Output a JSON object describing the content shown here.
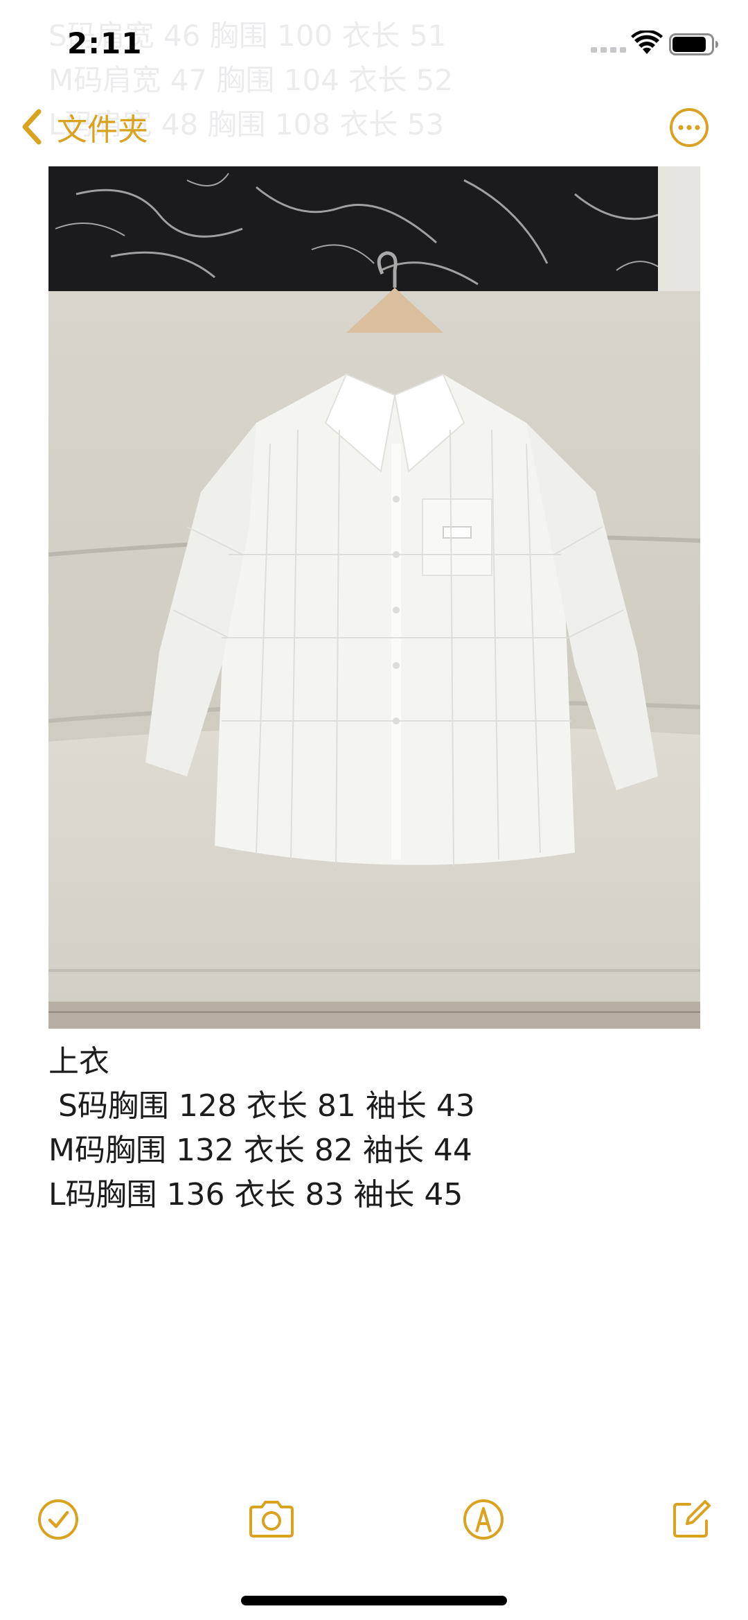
{
  "status_bar": {
    "time": "2:11"
  },
  "ghost_text": [
    "S码肩宽 46 胸围 100 衣长 51",
    "M码肩宽 47 胸围 104 衣长 52",
    "L码肩宽 48 胸围 108 衣长 53"
  ],
  "nav": {
    "back_label": "文件夹",
    "more_icon": "ellipsis-circle-icon"
  },
  "colors": {
    "accent": "#d9a21f",
    "text": "#1c1c1e"
  },
  "note": {
    "lines": [
      "上衣",
      " S码胸围 128 衣长 81 袖长 43",
      "M码胸围 132 衣长 82 袖长 44",
      "L码胸围 136 衣长 83 袖长 45"
    ]
  },
  "toolbar": {
    "icons": [
      "checklist-icon",
      "camera-icon",
      "markup-icon",
      "compose-icon"
    ]
  }
}
